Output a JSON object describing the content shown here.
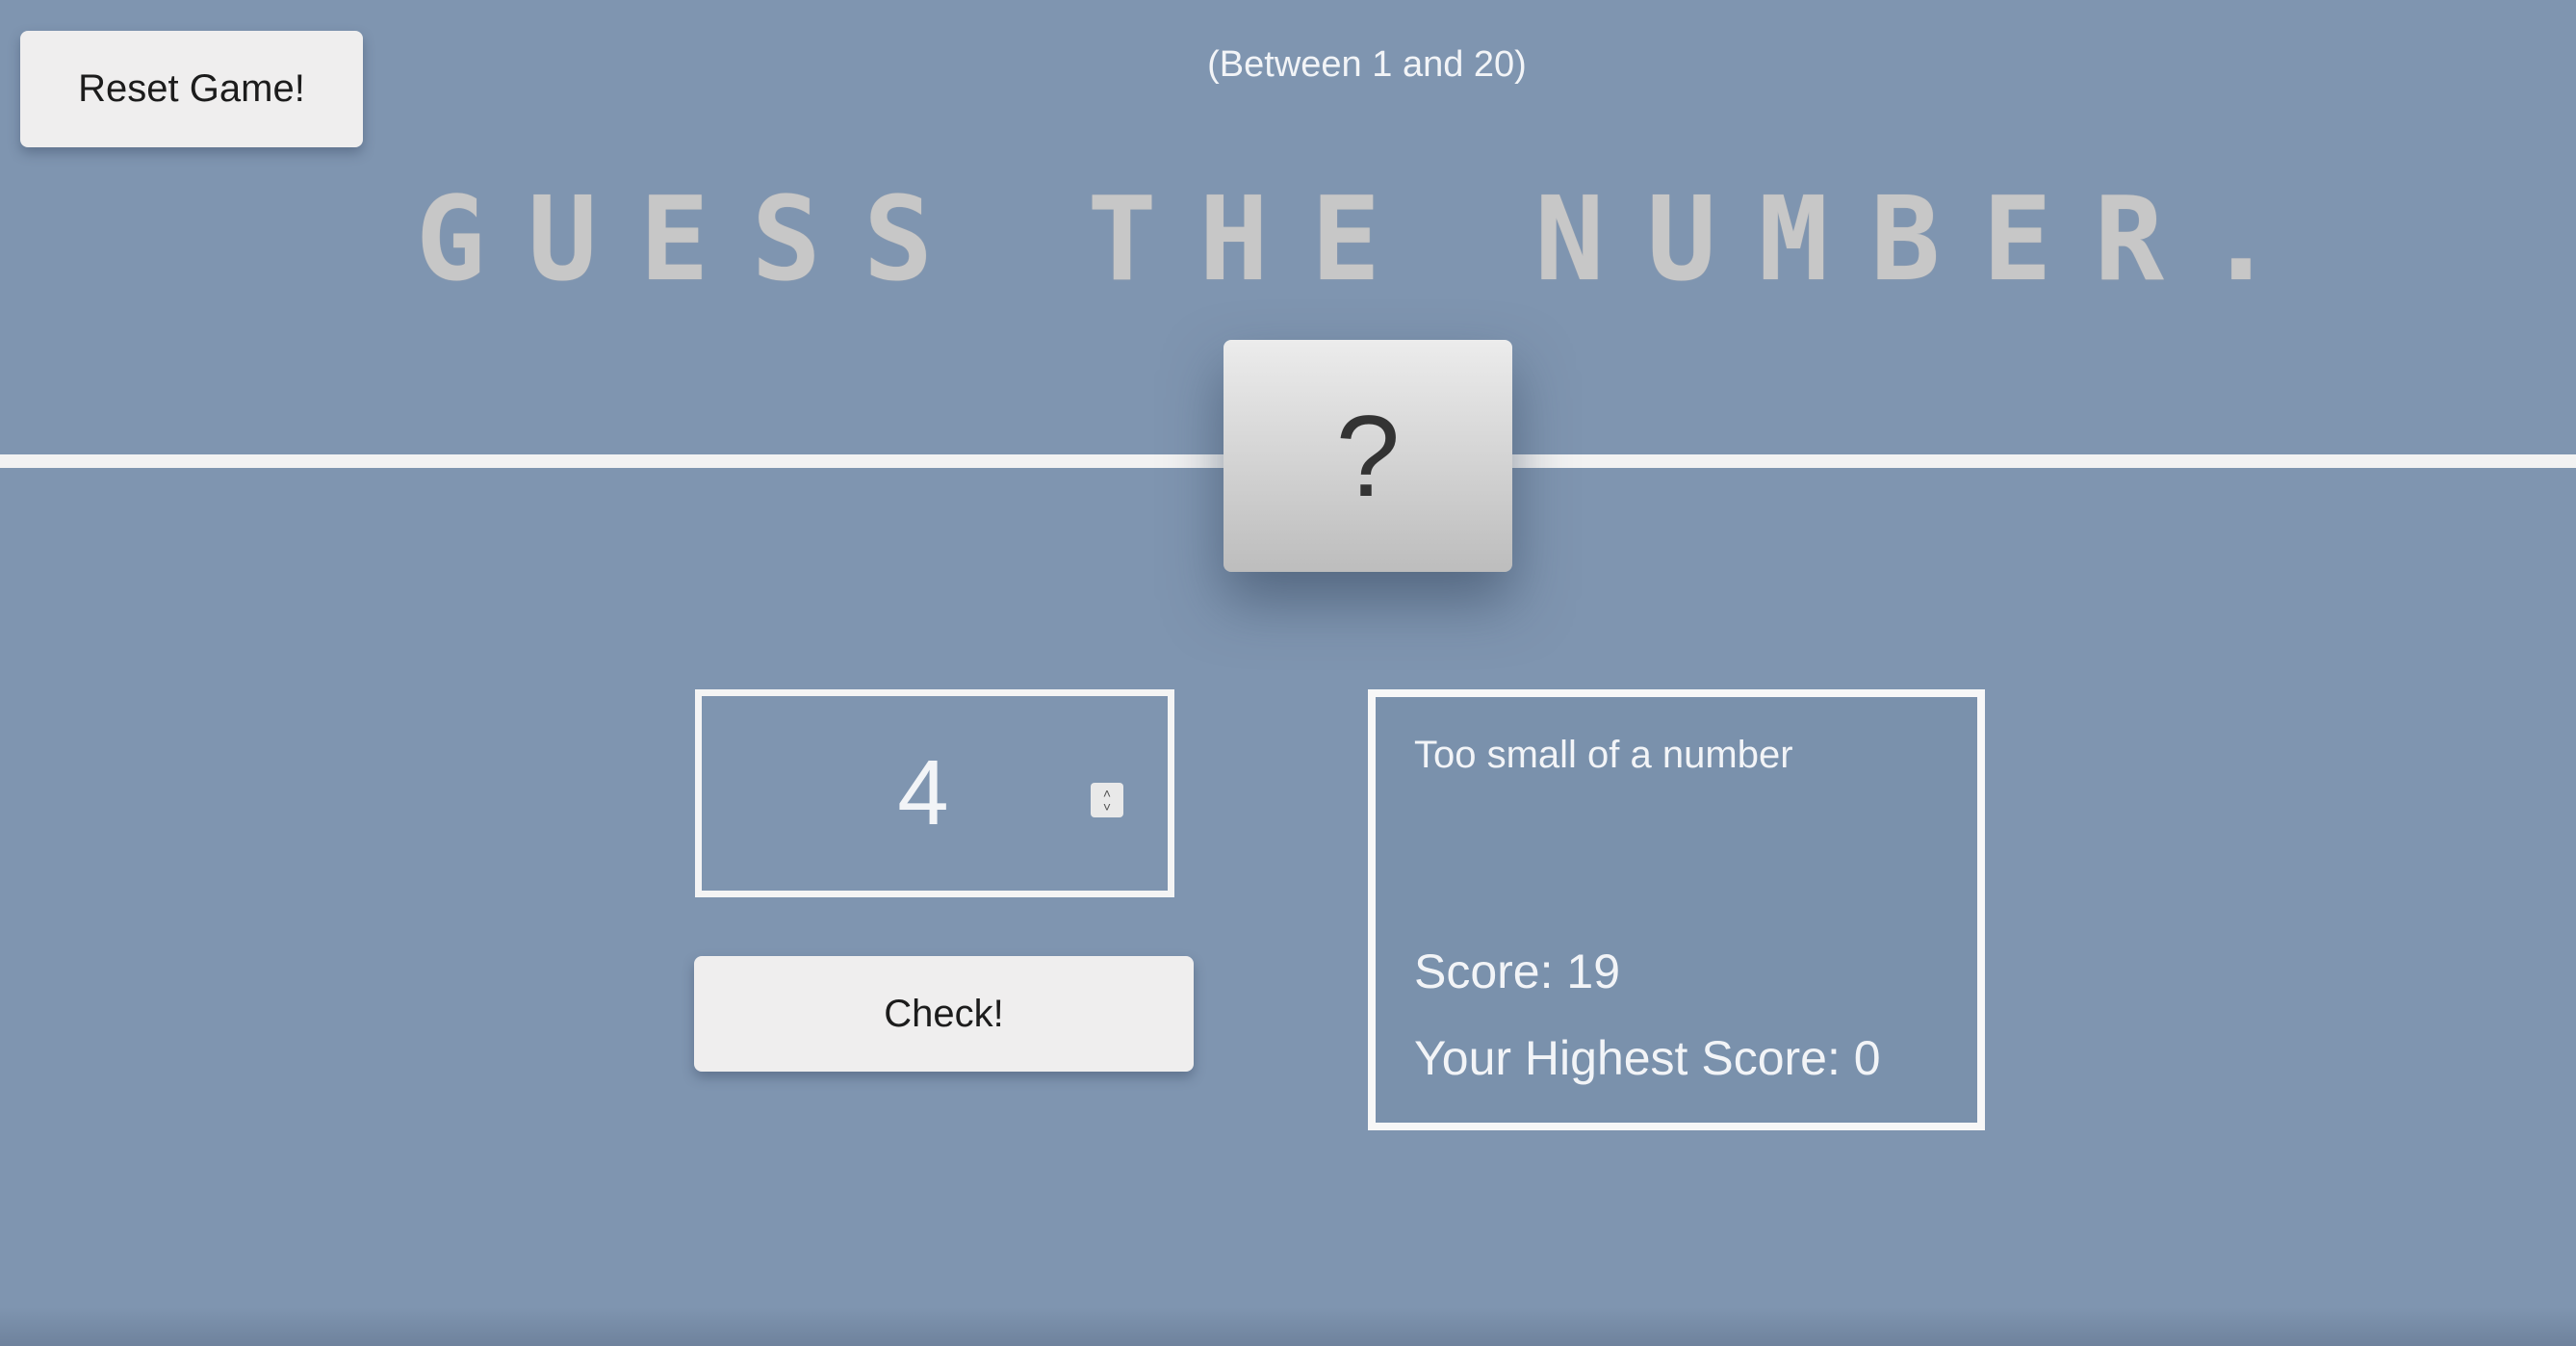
{
  "controls": {
    "reset_label": "Reset Game!",
    "check_label": "Check!"
  },
  "header": {
    "hint": "(Between 1 and 20)",
    "title": "GUESS THE NUMBER."
  },
  "secret": {
    "display": "?"
  },
  "guess": {
    "value": "4",
    "spinner_up": "˄",
    "spinner_down": "˅"
  },
  "result": {
    "message": "Too small of a number",
    "score_text": "Score: 19",
    "highscore_text": "Your Highest Score: 0"
  },
  "colors": {
    "background": "#7f95b0",
    "button": "#efeeee",
    "border": "#f4f4f4"
  }
}
